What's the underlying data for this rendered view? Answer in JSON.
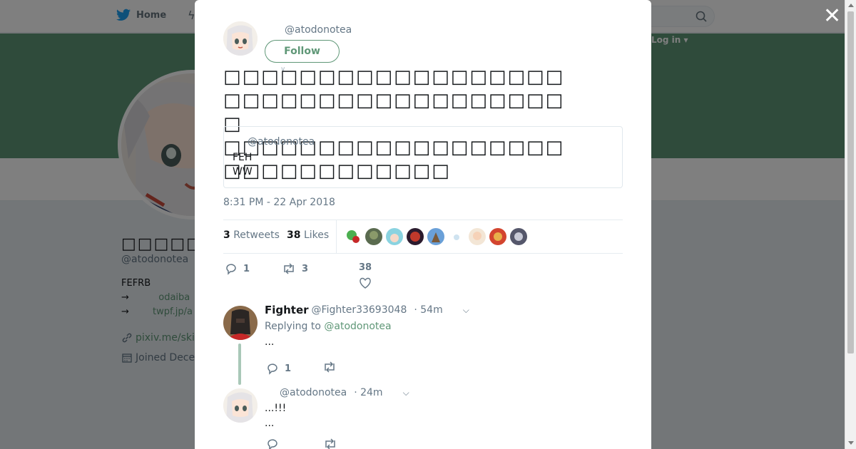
{
  "nav": {
    "home_label": "Home",
    "login_label": "Log in ▾"
  },
  "profile": {
    "display_name": "□□□□□",
    "handle": "@atodonotea",
    "bio_line1": "FEFRB",
    "bio_line2_prefix": "→",
    "bio_line2_link": "odaiba",
    "bio_line3_prefix": "→",
    "bio_line3_link": "twpf.jp/a",
    "website": "pixiv.me/ski",
    "joined": "Joined Dece"
  },
  "tweet": {
    "handle": "@atodonotea",
    "follow_label": "Follow",
    "text_line1": "□□□□□□□□□□□□□□□□□□□□□□□□□□□□□□□□□□□□□",
    "text_line2": "□□□□□□□□□□□□□□□□□□□□□□□□□□□□□□",
    "quote_handle": "@atodonotea",
    "quote_line1": "FEH",
    "quote_line2": "WW",
    "timestamp": "8:31 PM - 22 Apr 2018",
    "retweets_count": "3",
    "retweets_label": "Retweets",
    "likes_count": "38",
    "likes_label": "Likes",
    "reply_count": "1",
    "retweet_count": "3",
    "like_count": "38"
  },
  "replies": [
    {
      "name": "Fighter",
      "handle": "@Fighter33693048",
      "time": "· 54m",
      "replying_prefix": "Replying to",
      "replying_to": "@atodonotea",
      "text": "...",
      "reply_count": "1"
    },
    {
      "handle": "@atodonotea",
      "time": "· 24m",
      "text_line1": "...!!!",
      "text_line2": "..."
    }
  ],
  "colors": {
    "accent": "#5f9777",
    "overlay": "rgba(0,0,0,0.5)"
  }
}
